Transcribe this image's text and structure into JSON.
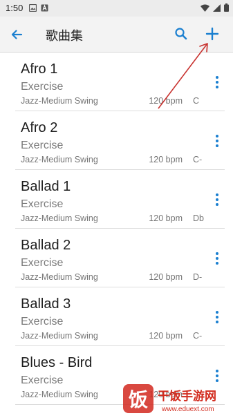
{
  "status_bar": {
    "time": "1:50"
  },
  "app_bar": {
    "title": "歌曲集",
    "back_icon": "arrow-back-icon",
    "search_icon": "search-icon",
    "add_icon": "plus-icon"
  },
  "accent_color": "#1a7fd0",
  "songs": [
    {
      "title": "Afro 1",
      "subtitle": "Exercise",
      "style": "Jazz-Medium Swing",
      "tempo": "120 bpm",
      "key": "C"
    },
    {
      "title": "Afro 2",
      "subtitle": "Exercise",
      "style": "Jazz-Medium Swing",
      "tempo": "120 bpm",
      "key": "C-"
    },
    {
      "title": "Ballad 1",
      "subtitle": "Exercise",
      "style": "Jazz-Medium Swing",
      "tempo": "120 bpm",
      "key": "Db"
    },
    {
      "title": "Ballad 2",
      "subtitle": "Exercise",
      "style": "Jazz-Medium Swing",
      "tempo": "120 bpm",
      "key": "D-"
    },
    {
      "title": "Ballad 3",
      "subtitle": "Exercise",
      "style": "Jazz-Medium Swing",
      "tempo": "120 bpm",
      "key": "C-"
    },
    {
      "title": "Blues - Bird",
      "subtitle": "Exercise",
      "style": "Jazz-Medium Swing",
      "tempo": "120 bpm",
      "key": ""
    }
  ],
  "watermark": {
    "brand": "干饭手游网",
    "url": "www.eduext.com"
  }
}
